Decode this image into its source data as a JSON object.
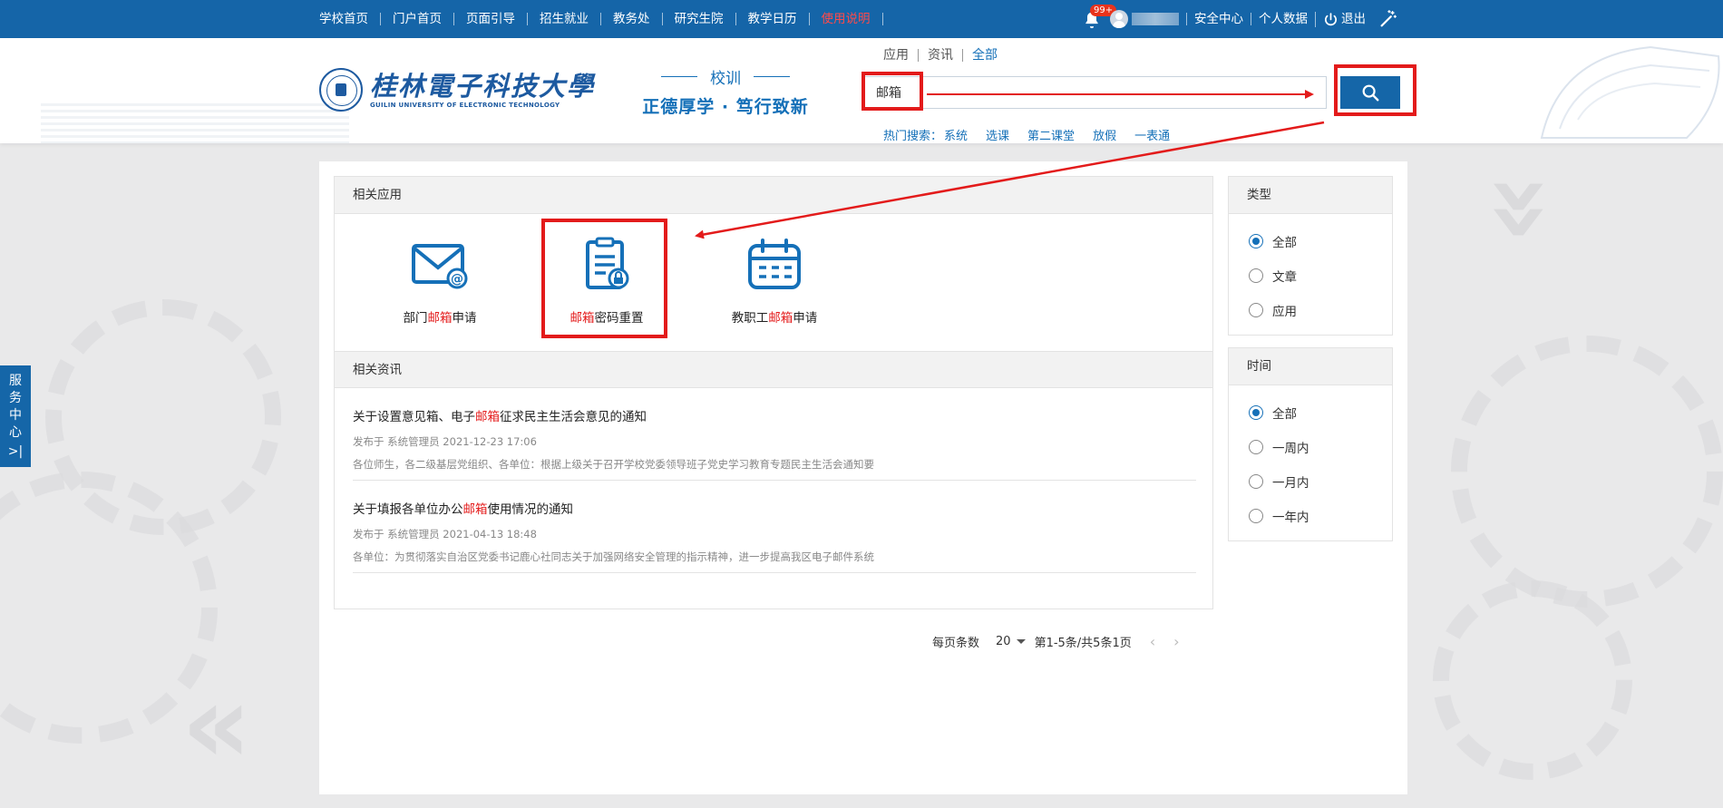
{
  "topnav": {
    "items": [
      "学校首页",
      "门户首页",
      "页面引导",
      "招生就业",
      "教务处",
      "研究生院",
      "教学日历",
      "使用说明"
    ],
    "notification_count": "99+",
    "right_items": [
      "安全中心",
      "个人数据",
      "退出"
    ]
  },
  "header": {
    "logo_cn": "桂林電子科技大學",
    "logo_en": "GUILIN UNIVERSITY OF ELECTRONIC TECHNOLOGY",
    "motto_title": "校训",
    "motto_text": "正德厚学 · 笃行致新"
  },
  "search": {
    "tabs": [
      "应用",
      "资讯",
      "全部"
    ],
    "query": "邮箱",
    "hot_label": "热门搜索：",
    "hot_keywords": [
      "系统",
      "选课",
      "第二课堂",
      "放假",
      "一表通"
    ]
  },
  "apps": {
    "section_title": "相关应用",
    "items": [
      {
        "prefix": "部门",
        "highlight": "邮箱",
        "suffix": "申请",
        "icon": "mail-icon"
      },
      {
        "prefix": "",
        "highlight": "邮箱",
        "suffix": "密码重置",
        "icon": "password-reset-icon"
      },
      {
        "prefix": "教职工",
        "highlight": "邮箱",
        "suffix": "申请",
        "icon": "calendar-icon"
      }
    ]
  },
  "news": {
    "section_title": "相关资讯",
    "items": [
      {
        "title_prefix": "关于设置意见箱、电子",
        "title_highlight": "邮箱",
        "title_suffix": "征求民主生活会意见的通知",
        "meta": "发布于 系统管理员 2021-12-23 17:06",
        "abstract": "各位师生，各二级基层党组织、各单位：根据上级关于召开学校党委领导班子党史学习教育专题民主生活会通知要"
      },
      {
        "title_prefix": "关于填报各单位办公",
        "title_highlight": "邮箱",
        "title_suffix": "使用情况的通知",
        "meta": "发布于 系统管理员 2021-04-13 18:48",
        "abstract": "各单位：为贯彻落实自治区党委书记鹿心社同志关于加强网络安全管理的指示精神，进一步提高我区电子邮件系统"
      }
    ]
  },
  "pager": {
    "label": "每页条数",
    "page_size": "20",
    "range": "第1-5条/共5条1页"
  },
  "filters": {
    "type": {
      "title": "类型",
      "options": [
        "全部",
        "文章",
        "应用"
      ],
      "selected": "全部"
    },
    "time": {
      "title": "时间",
      "options": [
        "全部",
        "一周内",
        "一月内",
        "一年内"
      ],
      "selected": "全部"
    }
  },
  "side_tab": {
    "label": "服务中心"
  },
  "colors": {
    "primary": "#1566a8",
    "highlight": "#e41c1c",
    "annotation": "#e31b1b"
  }
}
